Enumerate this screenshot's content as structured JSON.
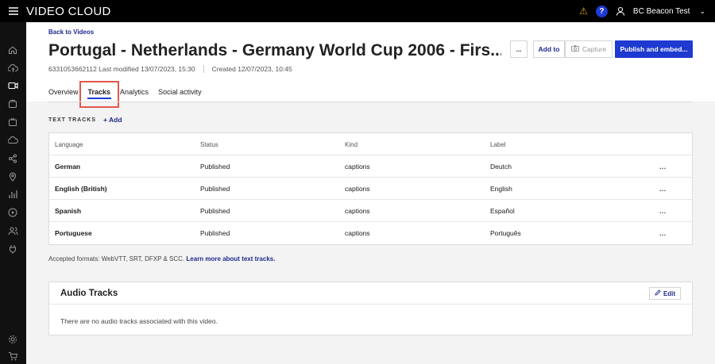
{
  "app": {
    "brand": "VIDEO CLOUD"
  },
  "user": {
    "name": "BC Beacon Test"
  },
  "help_label": "?",
  "header": {
    "back_link": "Back to Videos",
    "title": "Portugal - Netherlands - Germany World Cup 2006 - Firs...",
    "video_id_modified": "6331053662112 Last modified 13/07/2023, 15:30",
    "created": "Created 12/07/2023, 10:45"
  },
  "actions": {
    "more": "...",
    "add_to": "Add to",
    "capture": "Capture",
    "publish": "Publish and embed..."
  },
  "tabs": [
    {
      "label": "Overview"
    },
    {
      "label": "Tracks"
    },
    {
      "label": "Analytics"
    },
    {
      "label": "Social activity"
    }
  ],
  "text_tracks": {
    "section_label": "TEXT TRACKS",
    "add_label": "+ Add",
    "columns": [
      "Language",
      "Status",
      "Kind",
      "Label"
    ],
    "rows": [
      {
        "language": "German",
        "status": "Published",
        "kind": "captions",
        "label": "Deutch"
      },
      {
        "language": "English (British)",
        "status": "Published",
        "kind": "captions",
        "label": "English"
      },
      {
        "language": "Spanish",
        "status": "Published",
        "kind": "captions",
        "label": "Español"
      },
      {
        "language": "Portuguese",
        "status": "Published",
        "kind": "captions",
        "label": "Português"
      }
    ],
    "row_menu": "...",
    "formats_text": "Accepted formats: WebVTT, SRT, DFXP & SCC.",
    "learn_more": "Learn more about text tracks."
  },
  "audio_tracks": {
    "title": "Audio Tracks",
    "edit_label": "Edit",
    "empty_message": "There are no audio tracks associated with this video."
  },
  "colors": {
    "accent": "#1f3ad1",
    "highlight": "#e2574c",
    "topbar": "#000000",
    "warning": "#e8a317"
  }
}
